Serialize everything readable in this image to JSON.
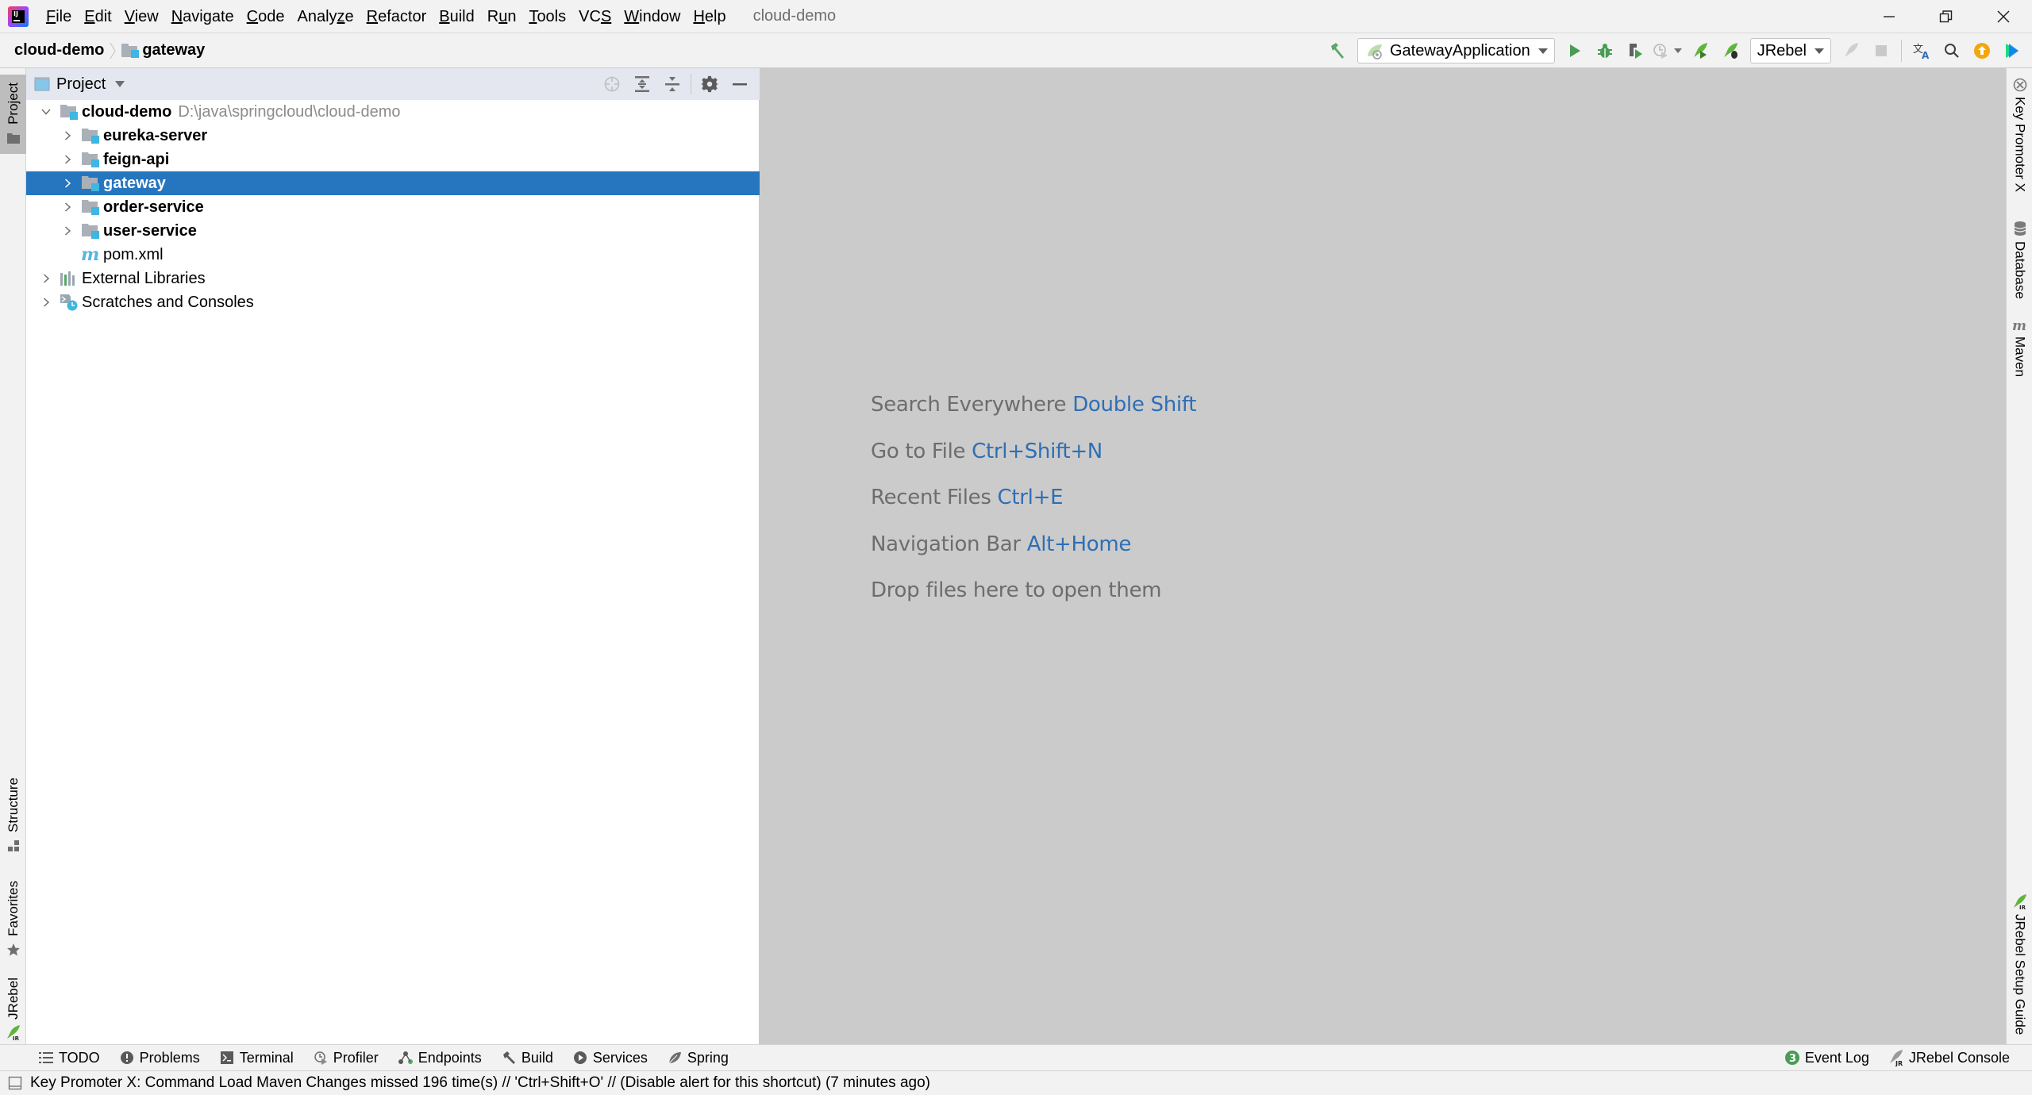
{
  "app": {
    "window_title": "cloud-demo",
    "menu": [
      {
        "label": "File",
        "mnemonic": "F",
        "rest": "ile"
      },
      {
        "label": "Edit",
        "mnemonic": "E",
        "rest": "dit"
      },
      {
        "label": "View",
        "mnemonic": "V",
        "rest": "iew"
      },
      {
        "label": "Navigate",
        "mnemonic": "N",
        "rest": "avigate"
      },
      {
        "label": "Code",
        "mnemonic": "C",
        "rest": "ode"
      },
      {
        "label": "Analyze",
        "pre": "Analy",
        "mnemonic": "z",
        "rest": "e"
      },
      {
        "label": "Refactor",
        "mnemonic": "R",
        "rest": "efactor"
      },
      {
        "label": "Build",
        "mnemonic": "B",
        "rest": "uild"
      },
      {
        "label": "Run",
        "pre": "R",
        "mnemonic": "u",
        "rest": "n"
      },
      {
        "label": "Tools",
        "mnemonic": "T",
        "rest": "ools"
      },
      {
        "label": "VCS",
        "pre": "VC",
        "mnemonic": "S",
        "rest": ""
      },
      {
        "label": "Window",
        "mnemonic": "W",
        "rest": "indow"
      },
      {
        "label": "Help",
        "mnemonic": "H",
        "rest": "elp"
      }
    ]
  },
  "breadcrumb": {
    "project": "cloud-demo",
    "module": "gateway"
  },
  "toolbar": {
    "run_config": "GatewayApplication",
    "jrebel_config": "JRebel"
  },
  "project_panel": {
    "title": "Project",
    "tree": [
      {
        "label": "cloud-demo",
        "hint": "D:\\java\\springcloud\\cloud-demo",
        "level": 0,
        "expanded": true,
        "icon": "module-folder-icon",
        "bold": true
      },
      {
        "label": "eureka-server",
        "level": 1,
        "expanded": false,
        "icon": "module-folder-icon",
        "bold": true
      },
      {
        "label": "feign-api",
        "level": 1,
        "expanded": false,
        "icon": "module-folder-icon",
        "bold": true
      },
      {
        "label": "gateway",
        "level": 1,
        "expanded": false,
        "icon": "module-folder-icon",
        "bold": true,
        "selected": true
      },
      {
        "label": "order-service",
        "level": 1,
        "expanded": false,
        "icon": "module-folder-icon",
        "bold": true
      },
      {
        "label": "user-service",
        "level": 1,
        "expanded": false,
        "icon": "module-folder-icon",
        "bold": true
      },
      {
        "label": "pom.xml",
        "level": 1,
        "leaf": true,
        "icon": "maven-file-icon",
        "bold": false
      },
      {
        "label": "External Libraries",
        "level": 0,
        "expanded": false,
        "icon": "libraries-icon",
        "bold": false
      },
      {
        "label": "Scratches and Consoles",
        "level": 0,
        "expanded": false,
        "icon": "scratches-icon",
        "bold": false
      }
    ]
  },
  "editor": {
    "hints": [
      {
        "text": "Search Everywhere",
        "key": "Double Shift"
      },
      {
        "text": "Go to File",
        "key": "Ctrl+Shift+N"
      },
      {
        "text": "Recent Files",
        "key": "Ctrl+E"
      },
      {
        "text": "Navigation Bar",
        "key": "Alt+Home"
      },
      {
        "text": "Drop files here to open them",
        "key": ""
      }
    ]
  },
  "left_stripe": {
    "top": [
      {
        "label": "Project"
      }
    ],
    "bottom": [
      {
        "label": "Structure"
      },
      {
        "label": "Favorites"
      },
      {
        "label": "JRebel"
      }
    ]
  },
  "right_stripe": {
    "top": [
      {
        "label": "Key Promoter X"
      },
      {
        "label": "Database"
      },
      {
        "label": "Maven"
      }
    ],
    "bottom": [
      {
        "label": "JRebel Setup Guide"
      }
    ]
  },
  "bottom_tools": {
    "left": [
      {
        "label": "TODO",
        "icon": "list-icon"
      },
      {
        "label": "Problems",
        "icon": "problems-icon"
      },
      {
        "label": "Terminal",
        "icon": "terminal-icon"
      },
      {
        "label": "Profiler",
        "icon": "profiler-icon"
      },
      {
        "label": "Endpoints",
        "icon": "endpoints-icon"
      },
      {
        "label": "Build",
        "icon": "hammer-icon"
      },
      {
        "label": "Services",
        "icon": "services-icon"
      },
      {
        "label": "Spring",
        "icon": "spring-leaf-icon"
      }
    ],
    "right": [
      {
        "label": "Event Log",
        "badge": "3"
      },
      {
        "label": "JRebel Console"
      }
    ]
  },
  "status_bar": {
    "message": "Key Promoter X: Command Load Maven Changes missed 196 time(s) // 'Ctrl+Shift+O' // (Disable alert for this shortcut) (7 minutes ago)"
  },
  "colors": {
    "selection": "#2675bf",
    "editor_bg": "#cbcbcb",
    "shortcut": "#2f6eb5",
    "hint_text": "#6d6d6d",
    "panel_header": "#e4e7ef"
  }
}
